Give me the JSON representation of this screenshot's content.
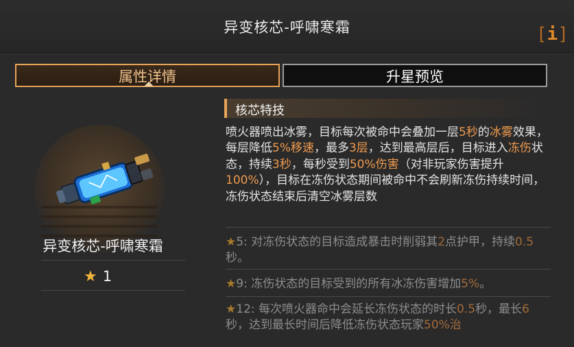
{
  "header": {
    "title": "异变核芯-呼啸寒霜",
    "info_icon": "info-icon"
  },
  "tabs": [
    {
      "label": "属性详情",
      "active": true
    },
    {
      "label": "升星预览",
      "active": false
    }
  ],
  "item": {
    "name": "异变核芯-呼啸寒霜",
    "star_level": "1",
    "icon": "frost-flamethrower-core-icon"
  },
  "section": {
    "title": "核芯特技"
  },
  "description": [
    [
      "喷火器喷出冰雾，目标每次被命中会叠加一层",
      "5秒",
      "的",
      "冰雾",
      "效果，每层降低",
      "5%移速",
      "，最多",
      "3层",
      "，达到最高层后，目标进入",
      "冻伤",
      "状态，持续",
      "3秒",
      "，每秒受到",
      "50%伤害",
      "（对非玩家伤害提升",
      "100%",
      "），目标在冻伤状态期间被命中不会刷新冻伤持续时间，冻伤状态结束后清空冰雾层数"
    ]
  ],
  "upgrades": [
    {
      "prefix": "5: 对冻伤状态的目标造成暴击时削弱其",
      "hl1": "2",
      "mid": "点护甲，持续",
      "hl2": "0.5",
      "suffix": "秒。"
    },
    {
      "prefix": "9: 冻伤状态的目标受到的所有冰冻伤害增加",
      "hl1": "5%",
      "mid": "。",
      "hl2": "",
      "suffix": ""
    },
    {
      "prefix": "12: 每次喷火器命中会延长冻伤状态的时长",
      "hl1": "0.5",
      "mid": "秒，最长",
      "hl2": "6",
      "suffix": "秒，达到最长时间后降低冻伤状态玩家",
      "hl3": "50%治"
    }
  ],
  "colors": {
    "accent": "#e8a45a",
    "highlight": "#ef9a4d",
    "star": "#f3b53b",
    "background": "#2a2a2b"
  }
}
